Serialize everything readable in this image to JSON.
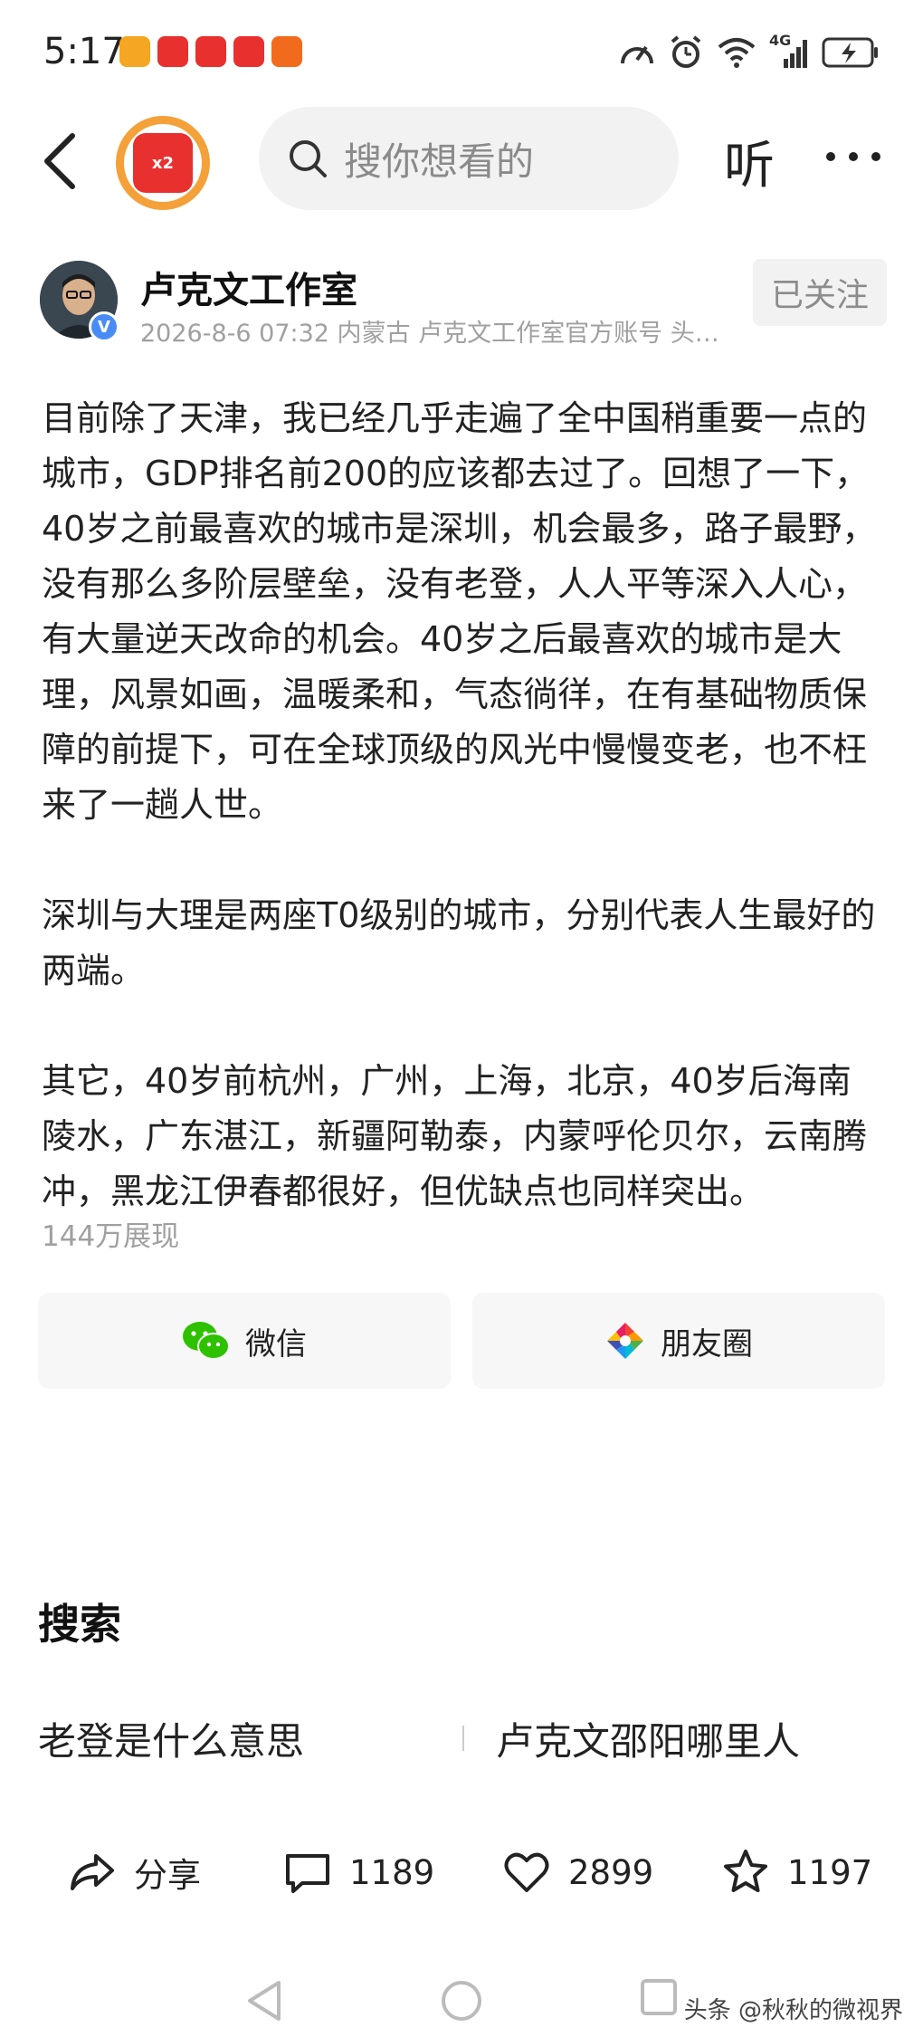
{
  "status_bar": {
    "time": "5:17",
    "network": "4G",
    "app_icons": [
      "tasks-app-icon",
      "video-app-icon",
      "video-app-icon-2",
      "toutiao-red-icon",
      "shopping-app-icon"
    ],
    "app_icon_colors": [
      "#f5a623",
      "#e8312f",
      "#e8312f",
      "#e8312f",
      "#f26b1d"
    ]
  },
  "nav": {
    "search_placeholder": "搜你想看的",
    "listen_label": "听",
    "coin_badge_text": "x2",
    "accent_color": "#f4a13a"
  },
  "author": {
    "name": "卢克文工作室",
    "meta": "2026-8-6 07:32 内蒙古 卢克文工作室官方账号 头…",
    "follow_label": "已关注",
    "verified_mark": "V"
  },
  "article": {
    "paragraphs": [
      "目前除了天津，我已经几乎走遍了全中国稍重要一点的城市，GDP排名前200的应该都去过了。回想了一下，40岁之前最喜欢的城市是深圳，机会最多，路子最野，没有那么多阶层壁垒，没有老登，人人平等深入人心，有大量逆天改命的机会。40岁之后最喜欢的城市是大理，风景如画，温暖柔和，气态徜徉，在有基础物质保障的前提下，可在全球顶级的风光中慢慢变老，也不枉来了一趟人世。",
      "深圳与大理是两座T0级别的城市，分别代表人生最好的两端。",
      "其它，40岁前杭州，广州，上海，北京，40岁后海南陵水，广东湛江，新疆阿勒泰，内蒙呼伦贝尔，云南腾冲，黑龙江伊春都很好，但优缺点也同样突出。"
    ],
    "views": "144万展现"
  },
  "share": {
    "wechat_label": "微信",
    "moments_label": "朋友圈"
  },
  "search_section": {
    "title": "搜索",
    "suggestions": [
      "老登是什么意思",
      "卢克文邵阳哪里人"
    ]
  },
  "actions": {
    "share_label": "分享",
    "comments": "1189",
    "likes": "2899",
    "favorites": "1197"
  },
  "watermark": "头条 @秋秋的微视界"
}
